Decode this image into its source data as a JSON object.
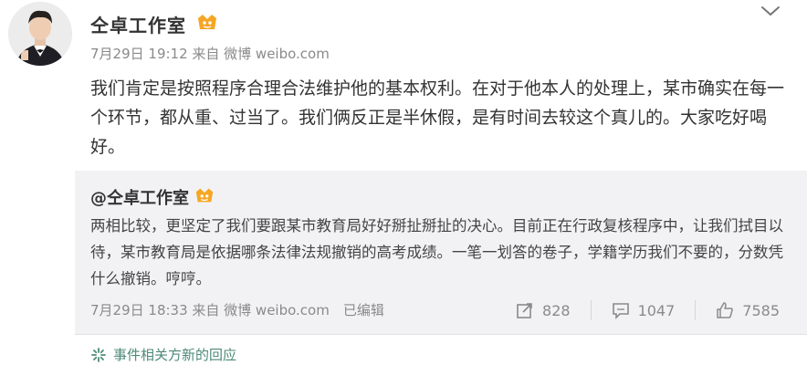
{
  "post": {
    "author": "仝卓工作室",
    "meta": "7月29日 19:12 来自 微博 weibo.com",
    "text": "我们肯定是按照程序合理合法维护他的基本权利。在对于他本人的处理上，某市确实在每一个环节，都从重、过当了。我们俩反正是半休假，是有时间去较这个真儿的。大家吃好喝好。"
  },
  "repost": {
    "author": "@仝卓工作室",
    "text": "两相比较，更坚定了我们要跟某市教育局好好掰扯掰扯的决心。目前正在行政复核程序中，让我们拭目以待，某市教育局是依据哪条法律法规撤销的高考成绩。一笔一划答的卷子，学籍学历我们不要的，分数凭什么撤销。哼哼。",
    "meta": "7月29日 18:33 来自 微博 weibo.com　已编辑",
    "reposts": "828",
    "comments": "1047",
    "likes": "7585"
  },
  "news_link": "事件相关方新的回应",
  "icons": {
    "menu": "chevron-down-icon",
    "vip": "vip-badge-icon",
    "repost": "repost-icon",
    "comment": "comment-icon",
    "like": "thumbs-up-icon",
    "news": "sparkle-icon"
  },
  "colors": {
    "repost_background": "#f2f2f5",
    "meta_text": "#8a8a8a",
    "news_link": "#4d8a78",
    "vip_badge": "#f6a623"
  }
}
